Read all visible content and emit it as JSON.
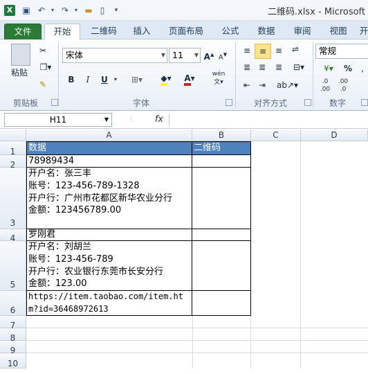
{
  "titlebar": {
    "title": "二维码.xlsx  -  Microsoft"
  },
  "tabs": [
    "文件",
    "开始",
    "二维码",
    "插入",
    "页面布局",
    "公式",
    "数据",
    "审阅",
    "视图",
    "开"
  ],
  "ribbon": {
    "clipboard": {
      "paste": "粘贴",
      "group": "剪贴板"
    },
    "font": {
      "name": "宋体",
      "size": "11",
      "bold": "B",
      "italic": "I",
      "underline": "U",
      "phonetic": "wén",
      "group": "字体"
    },
    "align": {
      "group": "对齐方式"
    },
    "number": {
      "format": "常规",
      "percent": "%",
      "group": "数字"
    }
  },
  "formula_bar": {
    "cell_ref": "H11",
    "fx": "fx",
    "content": ""
  },
  "columns": [
    "A",
    "B",
    "C",
    "D"
  ],
  "rows": [
    {
      "num": "1",
      "a": "数据",
      "b": "二维码"
    },
    {
      "num": "2",
      "a": "78989434",
      "b": ""
    },
    {
      "num": "3",
      "a": "开户名：张三丰\n账号：123-456-789-1328\n开户行：广州市花都区新华农业分行\n金额：123456789.00",
      "b": ""
    },
    {
      "num": "4",
      "a": "罗刚君",
      "b": ""
    },
    {
      "num": "5",
      "a": "开户名：刘胡兰\n账号：123-456-789\n开户行：农业银行东莞市长安分行\n金额：123.00",
      "b": ""
    },
    {
      "num": "6",
      "a": "https://item.taobao.com/item.htm?id=36468972613",
      "b": ""
    },
    {
      "num": "7",
      "a": "",
      "b": ""
    },
    {
      "num": "8",
      "a": "",
      "b": ""
    },
    {
      "num": "9",
      "a": "",
      "b": ""
    },
    {
      "num": "10",
      "a": "",
      "b": ""
    }
  ]
}
